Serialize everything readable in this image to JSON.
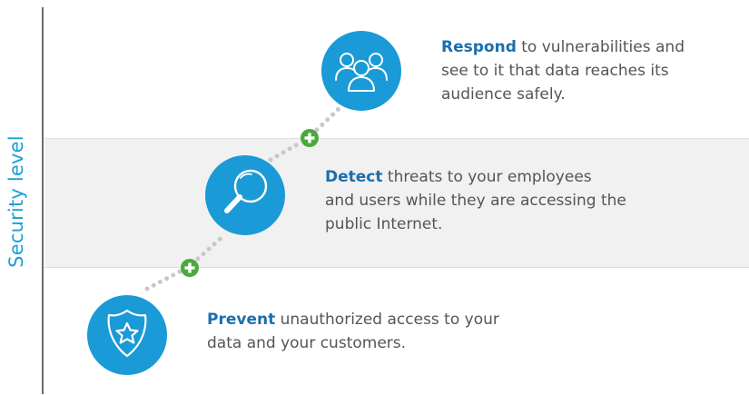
{
  "axis": {
    "label": "Security level"
  },
  "colors": {
    "circle": "#1a9ad6",
    "plus": "#4ca83e",
    "keyword": "#1a6fad",
    "text": "#555555",
    "band": "#f1f1f1",
    "axis_label": "#1ba0d8",
    "connector": "#c9c9c9"
  },
  "steps": [
    {
      "icon": "shield-star-icon",
      "keyword": "Prevent",
      "line1": " unauthorized access to your",
      "line2": "data and your customers.",
      "line3": ""
    },
    {
      "icon": "magnifier-icon",
      "keyword": "Detect",
      "line1": " threats to your employees",
      "line2": "and users while they are accessing the",
      "line3": "public Internet."
    },
    {
      "icon": "people-group-icon",
      "keyword": "Respond",
      "line1": " to vulnerabilities and",
      "line2": "see to it that data reaches its",
      "line3": "audience safely."
    }
  ]
}
